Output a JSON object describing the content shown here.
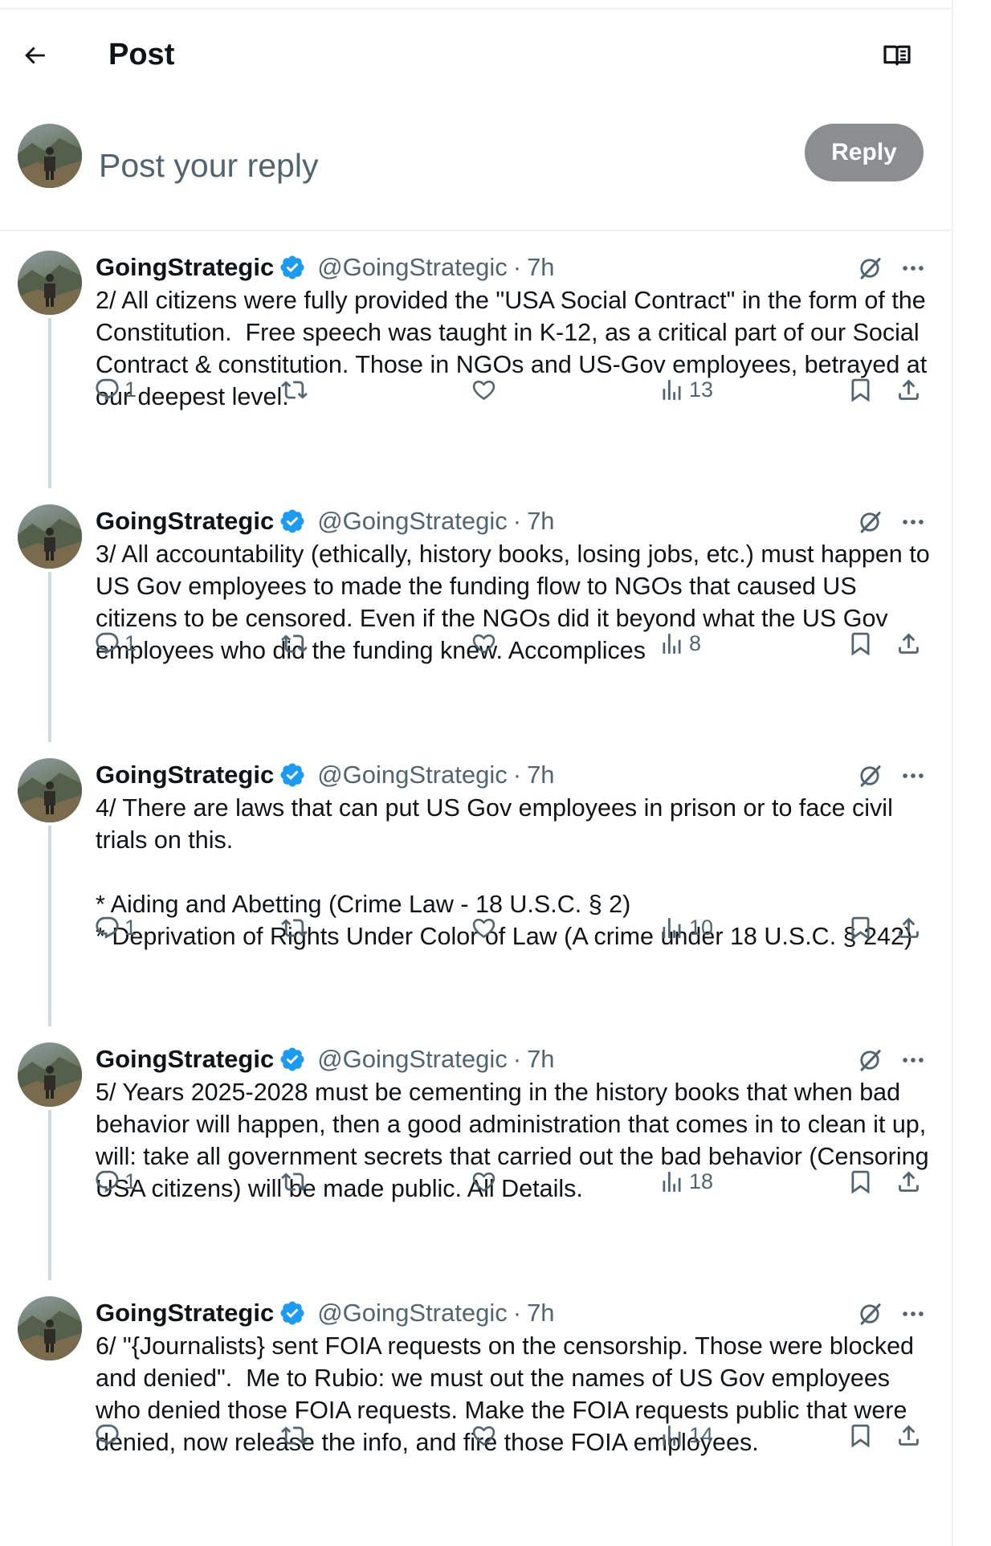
{
  "header": {
    "title": "Post"
  },
  "composer": {
    "placeholder": "Post your reply",
    "reply_label": "Reply"
  },
  "tweets": [
    {
      "name": "GoingStrategic",
      "handle": "@GoingStrategic",
      "separator": "·",
      "time": "7h",
      "text": "2/ All citizens were fully provided the \"USA Social Contract\" in the form of the Constitution.  Free speech was taught in K-12, as a critical part of our Social Contract & constitution. Those in NGOs and US-Gov employees, betrayed at our deepest level.",
      "replies": "1",
      "reposts": "",
      "likes": "",
      "views": "13"
    },
    {
      "name": "GoingStrategic",
      "handle": "@GoingStrategic",
      "separator": "·",
      "time": "7h",
      "text": "3/ All accountability (ethically, history books, losing jobs, etc.) must happen to US Gov employees to made the funding flow to NGOs that caused US citizens to be censored. Even if the NGOs did it beyond what the US Gov employees who did the funding knew. Accomplices",
      "replies": "1",
      "reposts": "",
      "likes": "",
      "views": "8"
    },
    {
      "name": "GoingStrategic",
      "handle": "@GoingStrategic",
      "separator": "·",
      "time": "7h",
      "text": "4/ There are laws that can put US Gov employees in prison or to face civil trials on this.\n\n* Aiding and Abetting (Crime Law - 18 U.S.C. § 2)\n* Deprivation of Rights Under Color of Law (A crime under 18 U.S.C. § 242)",
      "replies": "1",
      "reposts": "",
      "likes": "",
      "views": "10"
    },
    {
      "name": "GoingStrategic",
      "handle": "@GoingStrategic",
      "separator": "·",
      "time": "7h",
      "text": "5/ Years 2025-2028 must be cementing in the history books that when bad behavior will happen, then a good administration that comes in to clean it up, will: take all government secrets that carried out the bad behavior (Censoring USA citizens) will be made public. All Details.",
      "replies": "1",
      "reposts": "",
      "likes": "",
      "views": "18"
    },
    {
      "name": "GoingStrategic",
      "handle": "@GoingStrategic",
      "separator": "·",
      "time": "7h",
      "text": "6/ \"{Journalists} sent FOIA requests on the censorship. Those were blocked and denied\".  Me to Rubio: we must out the names of US Gov employees who denied those FOIA requests. Make the FOIA requests public that were denied, now release the info, and fire those FOIA employees.",
      "replies": "",
      "reposts": "",
      "likes": "",
      "views": "14"
    }
  ],
  "colors": {
    "text": "#0f1419",
    "secondary": "#536471",
    "verified": "#1d9bf0",
    "reply_button": "#8b8e90",
    "divider": "#eff3f4"
  },
  "icons": [
    "back-arrow-icon",
    "reader-mode-icon",
    "verified-badge-icon",
    "grok-icon",
    "more-icon",
    "reply-icon",
    "repost-icon",
    "like-icon",
    "views-icon",
    "bookmark-icon",
    "share-icon"
  ]
}
